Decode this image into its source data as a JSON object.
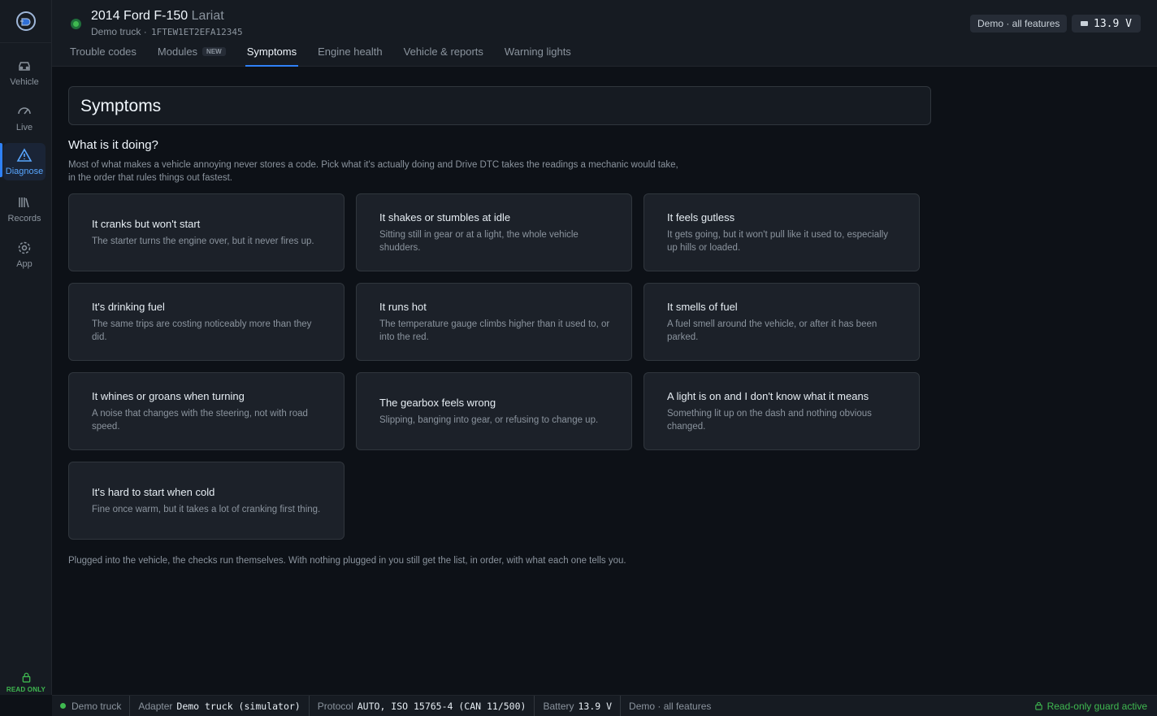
{
  "rail": {
    "items": [
      {
        "label": "Vehicle"
      },
      {
        "label": "Live"
      },
      {
        "label": "Diagnose"
      },
      {
        "label": "Records"
      },
      {
        "label": "App"
      }
    ],
    "read_only_label": "READ ONLY"
  },
  "header": {
    "vehicle_name": "2014 Ford F-150",
    "vehicle_trim": "Lariat",
    "vehicle_profile": "Demo truck",
    "vin": "1FTEW1ET2EFA12345",
    "demo_pill": "Demo · all features",
    "voltage": "13.9 V",
    "tabs": [
      {
        "label": "Trouble codes"
      },
      {
        "label": "Modules",
        "badge": "NEW"
      },
      {
        "label": "Symptoms",
        "active": true
      },
      {
        "label": "Engine health"
      },
      {
        "label": "Vehicle & reports"
      },
      {
        "label": "Warning lights"
      }
    ]
  },
  "main": {
    "title": "Symptoms",
    "question": "What is it doing?",
    "intro": "Most of what makes a vehicle annoying never stores a code. Pick what it's actually doing and Drive DTC takes the readings a mechanic would take, in the order that rules things out fastest.",
    "cards": [
      {
        "title": "It cranks but won't start",
        "desc": "The starter turns the engine over, but it never fires up."
      },
      {
        "title": "It shakes or stumbles at idle",
        "desc": "Sitting still in gear or at a light, the whole vehicle shudders."
      },
      {
        "title": "It feels gutless",
        "desc": "It gets going, but it won't pull like it used to, especially up hills or loaded."
      },
      {
        "title": "It's drinking fuel",
        "desc": "The same trips are costing noticeably more than they did."
      },
      {
        "title": "It runs hot",
        "desc": "The temperature gauge climbs higher than it used to, or into the red."
      },
      {
        "title": "It smells of fuel",
        "desc": "A fuel smell around the vehicle, or after it has been parked."
      },
      {
        "title": "It whines or groans when turning",
        "desc": "A noise that changes with the steering, not with road speed."
      },
      {
        "title": "The gearbox feels wrong",
        "desc": "Slipping, banging into gear, or refusing to change up."
      },
      {
        "title": "A light is on and I don't know what it means",
        "desc": "Something lit up on the dash and nothing obvious changed."
      },
      {
        "title": "It's hard to start when cold",
        "desc": "Fine once warm, but it takes a lot of cranking first thing."
      }
    ],
    "footnote": "Plugged into the vehicle, the checks run themselves. With nothing plugged in you still get the list, in order, with what each one tells you."
  },
  "statusbar": {
    "connection": "Demo truck",
    "adapter_label": "Adapter",
    "adapter_value": "Demo truck (simulator)",
    "protocol_label": "Protocol",
    "protocol_value": "AUTO, ISO 15765-4 (CAN 11/500)",
    "battery_label": "Battery",
    "battery_value": "13.9 V",
    "mode": "Demo · all features",
    "guard": "Read-only guard active"
  },
  "colors": {
    "accent": "#2f81f7",
    "ok": "#3fb950",
    "background": "#0d1117",
    "panel": "#161b22",
    "card": "#1c2129"
  },
  "icons": [
    "app-logo-icon",
    "car-icon",
    "gauge-icon",
    "warning-triangle-icon",
    "books-icon",
    "gear-icon",
    "lock-icon",
    "battery-icon"
  ]
}
